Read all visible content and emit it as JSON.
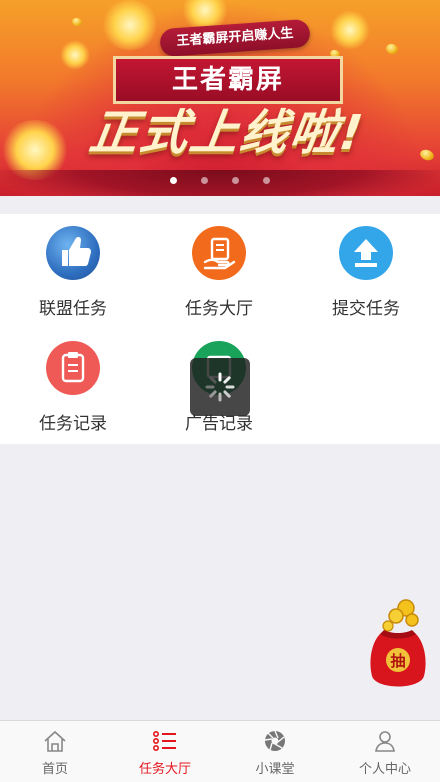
{
  "banner": {
    "subtitle": "王者霸屏开启赚人生",
    "title": "王者霸屏",
    "slogan": "正式上线啦!",
    "pager": {
      "count": 4,
      "active": 0
    }
  },
  "grid": {
    "items": [
      {
        "label": "联盟任务",
        "icon": "thumbs-up-icon",
        "color": "#2f6fc0"
      },
      {
        "label": "任务大厅",
        "icon": "hand-document-icon",
        "color": "#f26a1b"
      },
      {
        "label": "提交任务",
        "icon": "upload-arrow-icon",
        "color": "#33a6ea"
      },
      {
        "label": "任务记录",
        "icon": "clipboard-icon",
        "color": "#ef5a57"
      },
      {
        "label": "广告记录",
        "icon": "ad-record-icon",
        "color": "#1aa35a"
      }
    ]
  },
  "loading": {
    "icon": "spinner-icon"
  },
  "float": {
    "label": "抽",
    "icon": "red-packet-icon"
  },
  "tabbar": {
    "active_color": "#e4161d",
    "items": [
      {
        "label": "首页",
        "icon": "home-icon"
      },
      {
        "label": "任务大厅",
        "icon": "list-icon"
      },
      {
        "label": "小课堂",
        "icon": "aperture-icon"
      },
      {
        "label": "个人中心",
        "icon": "person-icon"
      }
    ],
    "active": 1
  }
}
